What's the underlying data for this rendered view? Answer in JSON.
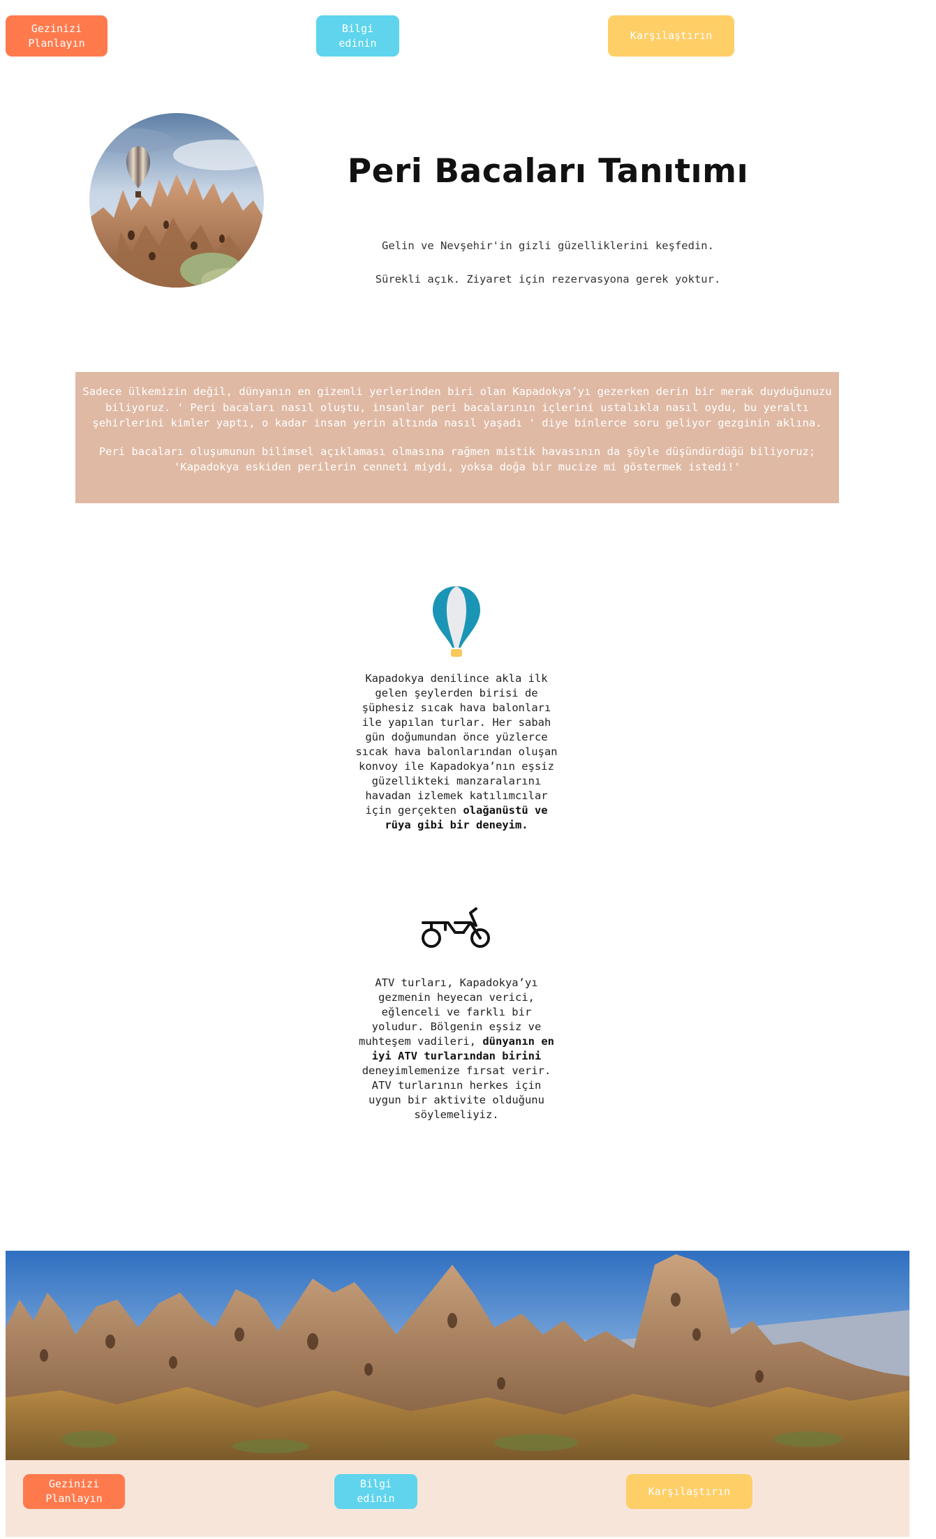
{
  "nav": {
    "plan_label": "Gezinizi\nPlanlayın",
    "info_label": "Bilgi\nedinin",
    "compare_label": "Karşılaştırın"
  },
  "hero": {
    "title": "Peri Bacaları Tanıtımı",
    "line1": "Gelin ve Nevşehir'in gizli güzelliklerini keşfedin.",
    "line2": "Sürekli açık. Ziyaret için rezervasyona gerek yoktur."
  },
  "intro": {
    "p1": "Sadece ülkemizin değil, dünyanın en gizemli yerlerinden biri olan Kapadokya’yı gezerken derin bir merak duyduğunuzu biliyoruz. ' Peri bacaları nasıl oluştu, insanlar peri bacalarının içlerini ustalıkla nasıl oydu, bu yeraltı şehirlerini kimler yaptı, o kadar insan yerin altında nasıl yaşadı ' diye binlerce soru geliyor gezginin aklına.",
    "p2": "Peri bacaları oluşumunun bilimsel açıklaması olmasına rağmen mistik havasının da şöyle düşündürdüğü biliyoruz; 'Kapadokya eskiden perilerin cenneti miydi, yoksa doğa bir mucize mi göstermek istedi!'"
  },
  "features": {
    "balloon": {
      "icon": "hot-air-balloon-icon",
      "text": "Kapadokya denilince akla ilk gelen şeylerden birisi de şüphesiz sıcak hava balonları ile yapılan turlar. Her sabah gün doğumundan önce yüzlerce sıcak hava balonlarından oluşan konvoy ile Kapadokya’nın eşsiz güzellikteki manzaralarını havadan izlemek katılımcılar için gerçekten ",
      "bold": "olağanüstü ve rüya gibi bir deneyim."
    },
    "atv": {
      "icon": "motorcycle-icon",
      "text_before": "ATV turları, Kapadokya’yı gezmenin heyecan verici, eğlenceli ve farklı bir yoludur. Bölgenin eşsiz ve muhteşem vadileri, ",
      "bold": "dünyanın en iyi ATV turlarından birini",
      "text_after": " deneyimlemenize fırsat verir. ATV turlarının herkes için uygun bir aktivite olduğunu söylemeliyiz."
    }
  },
  "footer": {
    "plan_label": "Gezinizi\nPlanlayın",
    "info_label": "Bilgi\nedinin",
    "compare_label": "Karşılaştırın"
  },
  "colors": {
    "orange": "#fe7a4d",
    "blue": "#5fd4ec",
    "yellow": "#fece67",
    "intro_bg": "#dfb9a4",
    "footer_bg": "#f8e5da"
  }
}
